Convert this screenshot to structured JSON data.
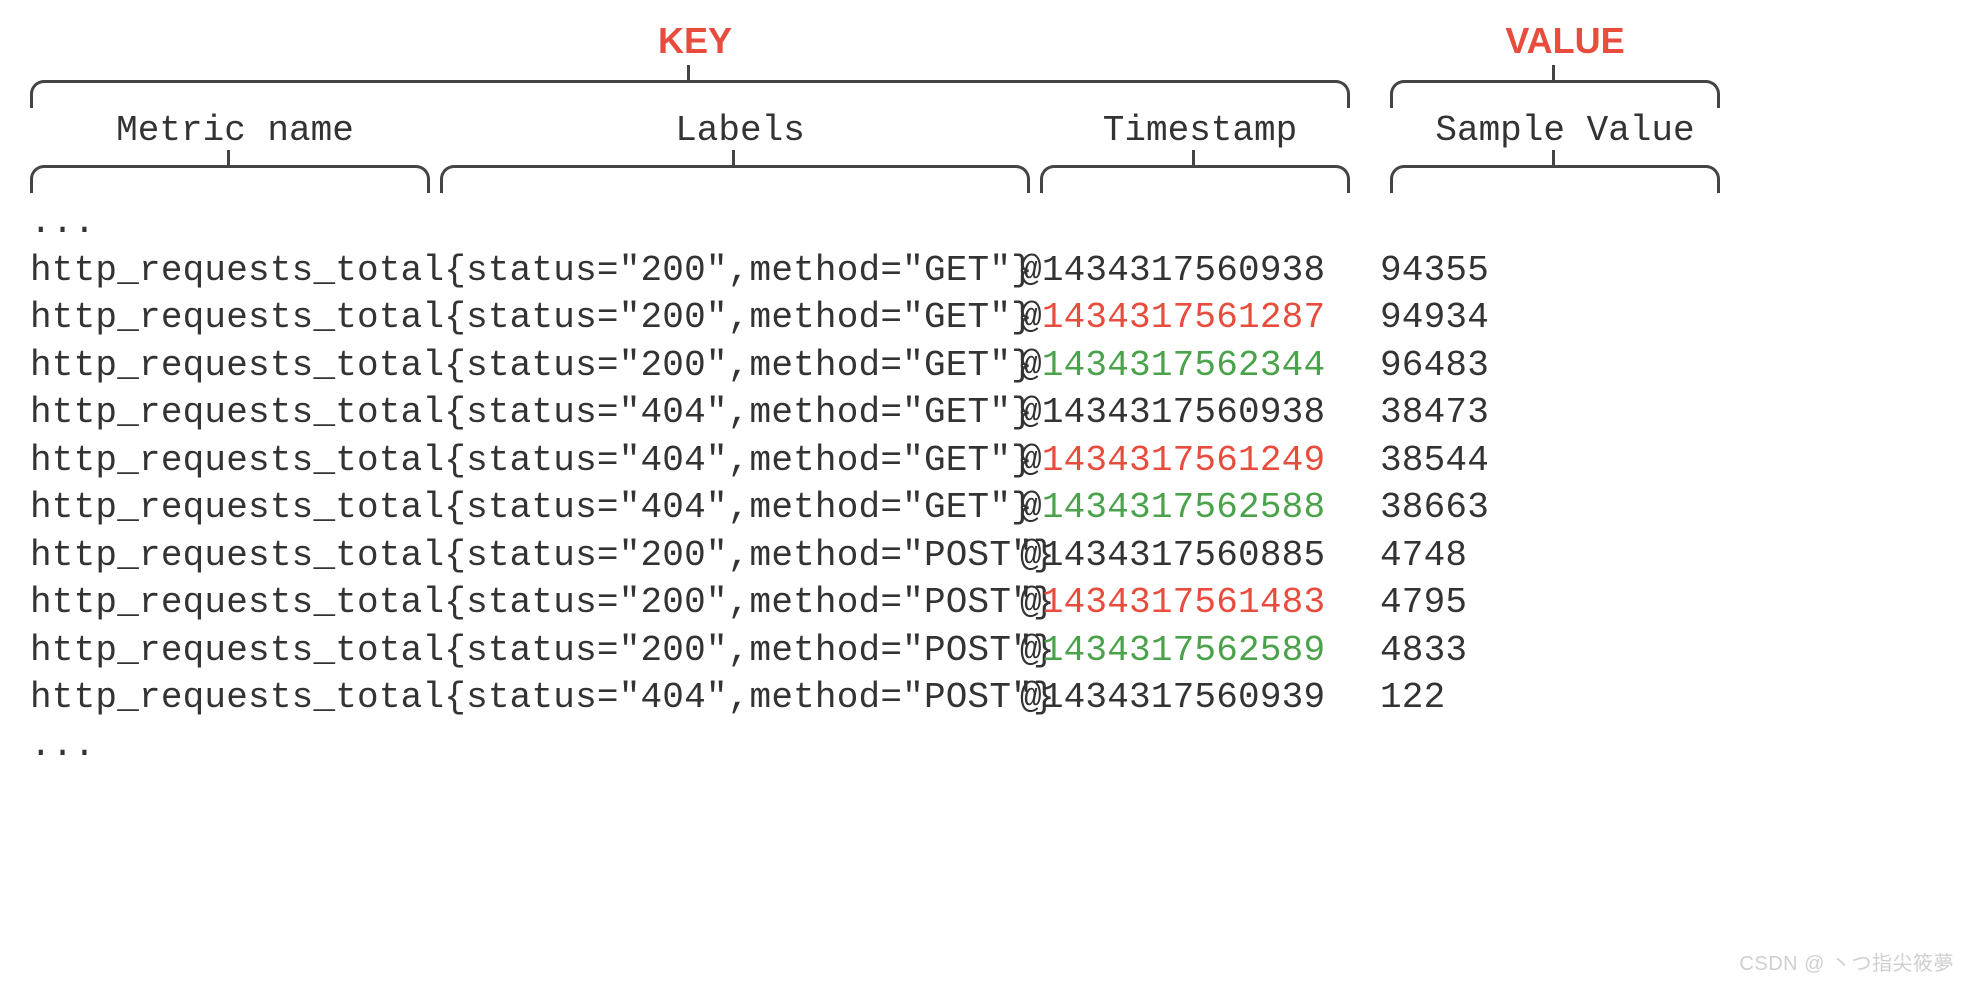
{
  "headers": {
    "key": "KEY",
    "value": "VALUE",
    "metric_name": "Metric name",
    "labels": "Labels",
    "timestamp": "Timestamp",
    "sample_value": "Sample Value"
  },
  "ellipsis": "...",
  "rows": [
    {
      "metric": "http_requests_total",
      "labels": "{status=\"200\",method=\"GET\"}",
      "ts_prefix": "@",
      "ts": "1434317560938",
      "ts_color": "",
      "value": "94355"
    },
    {
      "metric": "http_requests_total",
      "labels": "{status=\"200\",method=\"GET\"}",
      "ts_prefix": "@",
      "ts": "1434317561287",
      "ts_color": "orange",
      "value": "94934"
    },
    {
      "metric": "http_requests_total",
      "labels": "{status=\"200\",method=\"GET\"}",
      "ts_prefix": "@",
      "ts": "1434317562344",
      "ts_color": "green",
      "value": "96483"
    },
    {
      "metric": "http_requests_total",
      "labels": "{status=\"404\",method=\"GET\"}",
      "ts_prefix": "@",
      "ts": "1434317560938",
      "ts_color": "",
      "value": "38473"
    },
    {
      "metric": "http_requests_total",
      "labels": "{status=\"404\",method=\"GET\"}",
      "ts_prefix": "@",
      "ts": "1434317561249",
      "ts_color": "orange",
      "value": "38544"
    },
    {
      "metric": "http_requests_total",
      "labels": "{status=\"404\",method=\"GET\"}",
      "ts_prefix": "@",
      "ts": "1434317562588",
      "ts_color": "green",
      "value": "38663"
    },
    {
      "metric": "http_requests_total",
      "labels": "{status=\"200\",method=\"POST\"}",
      "ts_prefix": "@",
      "ts": "1434317560885",
      "ts_color": "",
      "value": "4748"
    },
    {
      "metric": "http_requests_total",
      "labels": "{status=\"200\",method=\"POST\"}",
      "ts_prefix": "@",
      "ts": "1434317561483",
      "ts_color": "orange",
      "value": "4795"
    },
    {
      "metric": "http_requests_total",
      "labels": "{status=\"200\",method=\"POST\"}",
      "ts_prefix": "@",
      "ts": "1434317562589",
      "ts_color": "green",
      "value": "4833"
    },
    {
      "metric": "http_requests_total",
      "labels": "{status=\"404\",method=\"POST\"}",
      "ts_prefix": "@",
      "ts": "1434317560939",
      "ts_color": "",
      "value": "122"
    }
  ],
  "watermark": "CSDN @ 丶つ指尖筱夢"
}
